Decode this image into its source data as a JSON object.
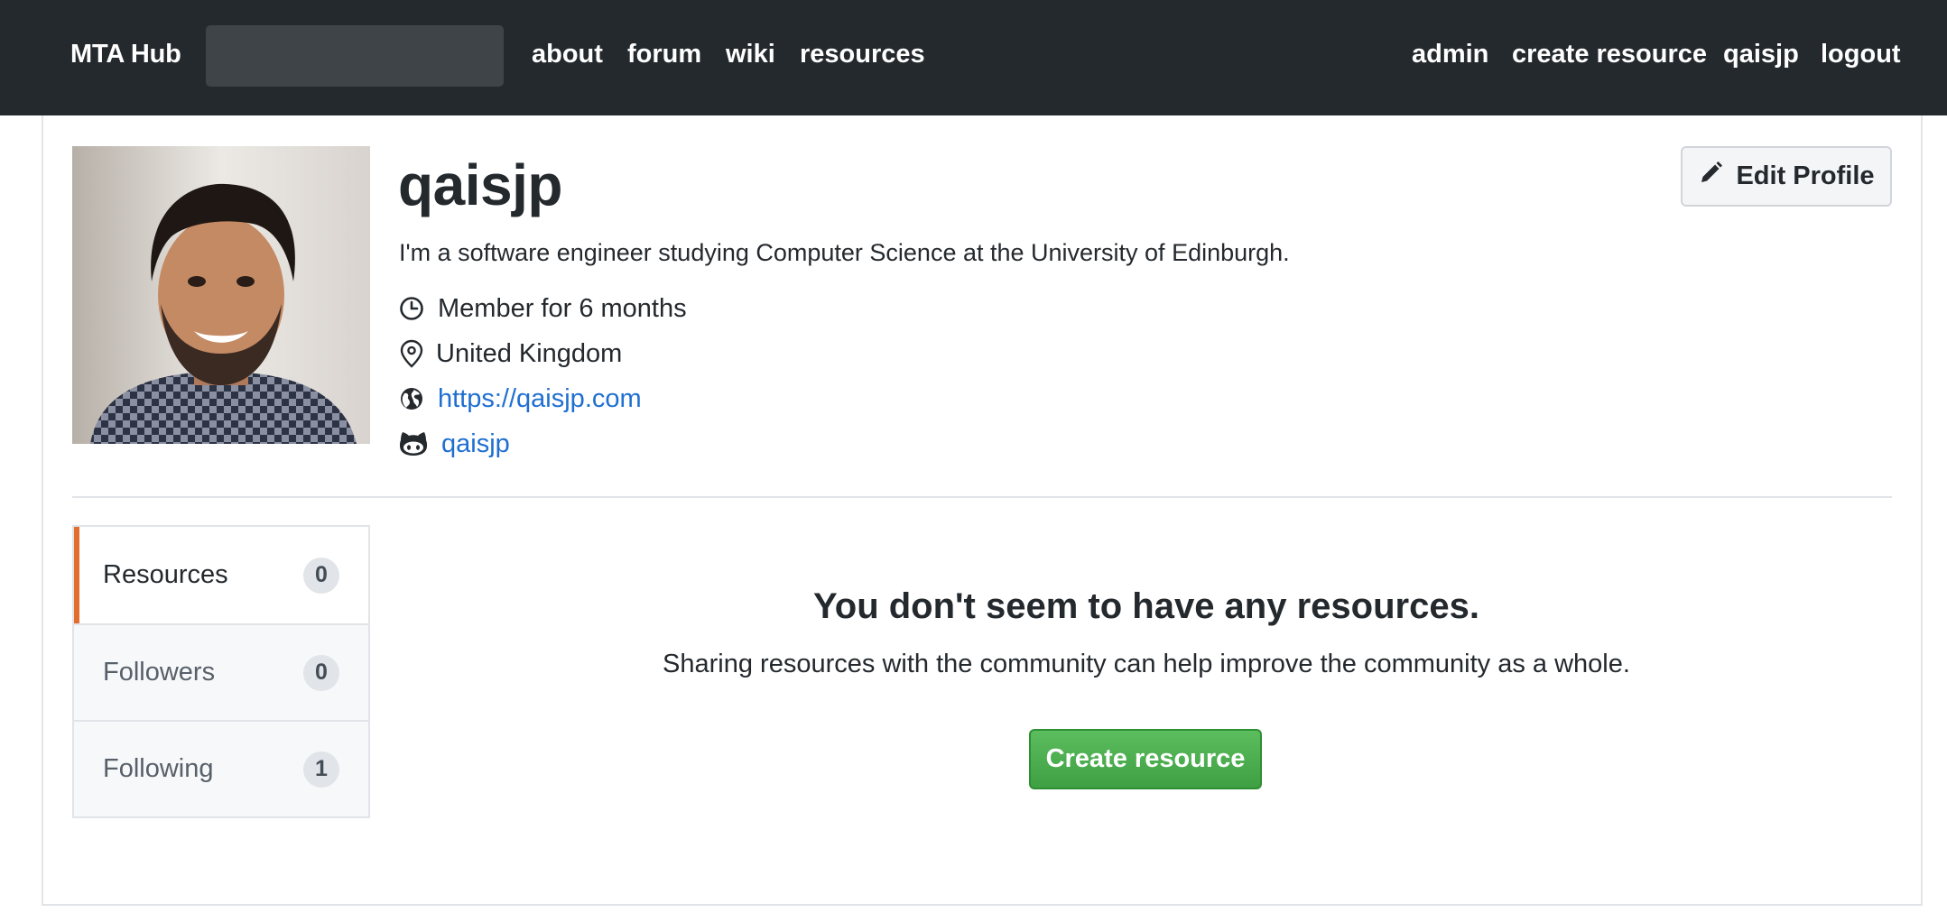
{
  "navbar": {
    "brand": "MTA Hub",
    "search": {
      "placeholder": "",
      "value": ""
    },
    "left_links": [
      "about",
      "forum",
      "wiki",
      "resources"
    ],
    "right_links": [
      "admin",
      "create resource",
      "qaisjp",
      "logout"
    ]
  },
  "profile": {
    "username": "qaisjp",
    "bio": "I'm a software engineer studying Computer Science at the University of Edinburgh.",
    "member_since": "Member for 6 months",
    "location": "United Kingdom",
    "website": "https://qaisjp.com",
    "github": "qaisjp",
    "edit_button": "Edit Profile",
    "avatar_icon": "user-photo"
  },
  "menu": {
    "items": [
      {
        "label": "Resources",
        "count": "0",
        "active": true
      },
      {
        "label": "Followers",
        "count": "0",
        "active": false
      },
      {
        "label": "Following",
        "count": "1",
        "active": false
      }
    ]
  },
  "empty_state": {
    "title": "You don't seem to have any resources.",
    "text": "Sharing resources with the community can help improve the community as a whole.",
    "button": "Create resource"
  },
  "colors": {
    "navbar": "#24292e",
    "link": "#1f6fd1",
    "accent": "#e36d2d",
    "success": "#4caf50"
  },
  "icons": [
    "clock-icon",
    "location-pin-icon",
    "globe-icon",
    "github-icon",
    "pencil-icon"
  ]
}
